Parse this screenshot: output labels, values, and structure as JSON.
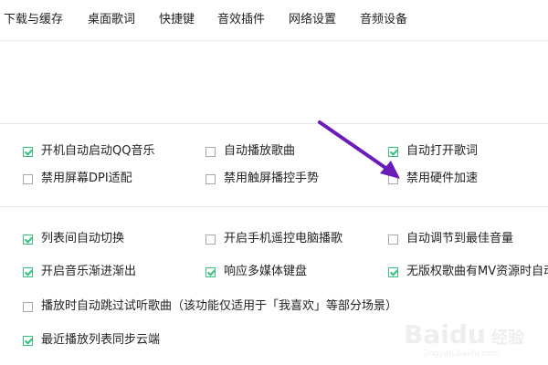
{
  "tabs": [
    "下载与缓存",
    "桌面歌词",
    "快捷键",
    "音效插件",
    "网络设置",
    "音频设备"
  ],
  "options": {
    "auto_start_qq_music": {
      "label": "开机自动启动QQ音乐",
      "checked": true
    },
    "auto_play_song": {
      "label": "自动播放歌曲",
      "checked": false
    },
    "auto_open_lyrics": {
      "label": "自动打开歌词",
      "checked": true
    },
    "disable_dpi_scaling": {
      "label": "禁用屏幕DPI适配",
      "checked": false
    },
    "disable_touch_gesture": {
      "label": "禁用触屏播控手势",
      "checked": false
    },
    "disable_hw_accel": {
      "label": "禁用硬件加速",
      "checked": false
    },
    "list_auto_switch": {
      "label": "列表间自动切换",
      "checked": true
    },
    "phone_remote_control": {
      "label": "开启手机遥控电脑播歌",
      "checked": false
    },
    "auto_best_volume": {
      "label": "自动调节到最佳音量",
      "checked": false
    },
    "fade_in_out": {
      "label": "开启音乐渐进渐出",
      "checked": true
    },
    "media_keyboard": {
      "label": "响应多媒体键盘",
      "checked": true
    },
    "mv_resource": {
      "label": "无版权歌曲有MV资源时自动",
      "checked": true
    },
    "skip_trial_songs": {
      "label": "播放时自动跳过试听歌曲（该功能仅适用于「我喜欢」等部分场景）",
      "checked": false
    },
    "sync_recent_cloud": {
      "label": "最近播放列表同步云端",
      "checked": true
    }
  },
  "colors": {
    "check": "#31c27c",
    "arrow": "#6a1bb8"
  },
  "watermark": {
    "brand": "Baidu",
    "sub": "经验",
    "url": "jingyan.baidu.com"
  }
}
